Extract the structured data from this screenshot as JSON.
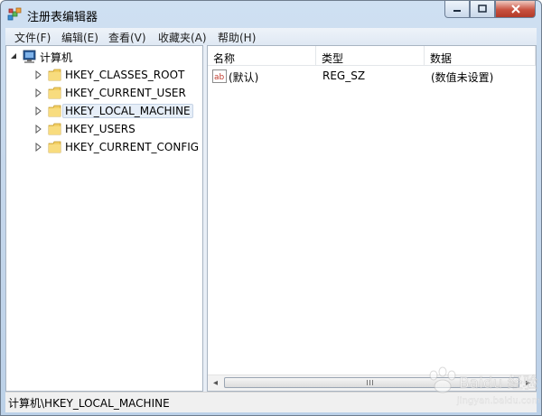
{
  "window": {
    "title": "注册表编辑器",
    "icon": "registry-editor-icon"
  },
  "caption_buttons": [
    {
      "name": "minimize",
      "icon": "minimize-icon"
    },
    {
      "name": "maximize",
      "icon": "maximize-icon"
    },
    {
      "name": "close",
      "icon": "close-icon"
    }
  ],
  "menu": [
    {
      "label": "文件(F)"
    },
    {
      "label": "编辑(E)"
    },
    {
      "label": "查看(V)"
    },
    {
      "label": "收藏夹(A)"
    },
    {
      "label": "帮助(H)"
    }
  ],
  "tree": {
    "root": {
      "label": "计算机",
      "icon": "computer-icon",
      "expanded": true
    },
    "children": [
      {
        "label": "HKEY_CLASSES_ROOT",
        "icon": "folder-icon",
        "selected": false
      },
      {
        "label": "HKEY_CURRENT_USER",
        "icon": "folder-icon",
        "selected": false
      },
      {
        "label": "HKEY_LOCAL_MACHINE",
        "icon": "folder-icon",
        "selected": true
      },
      {
        "label": "HKEY_USERS",
        "icon": "folder-icon",
        "selected": false
      },
      {
        "label": "HKEY_CURRENT_CONFIG",
        "icon": "folder-icon",
        "selected": false
      }
    ]
  },
  "list": {
    "columns": [
      "名称",
      "类型",
      "数据"
    ],
    "rows": [
      {
        "icon": "string-value-icon",
        "name": "(默认)",
        "type": "REG_SZ",
        "data": "(数值未设置)"
      }
    ]
  },
  "scrollbar": {
    "left_arrow": "◂",
    "right_arrow": "▸"
  },
  "status": {
    "path": "计算机\\HKEY_LOCAL_MACHINE"
  },
  "watermark": {
    "text": "Baidu 经验",
    "url": "jingyan.baidu.com"
  }
}
